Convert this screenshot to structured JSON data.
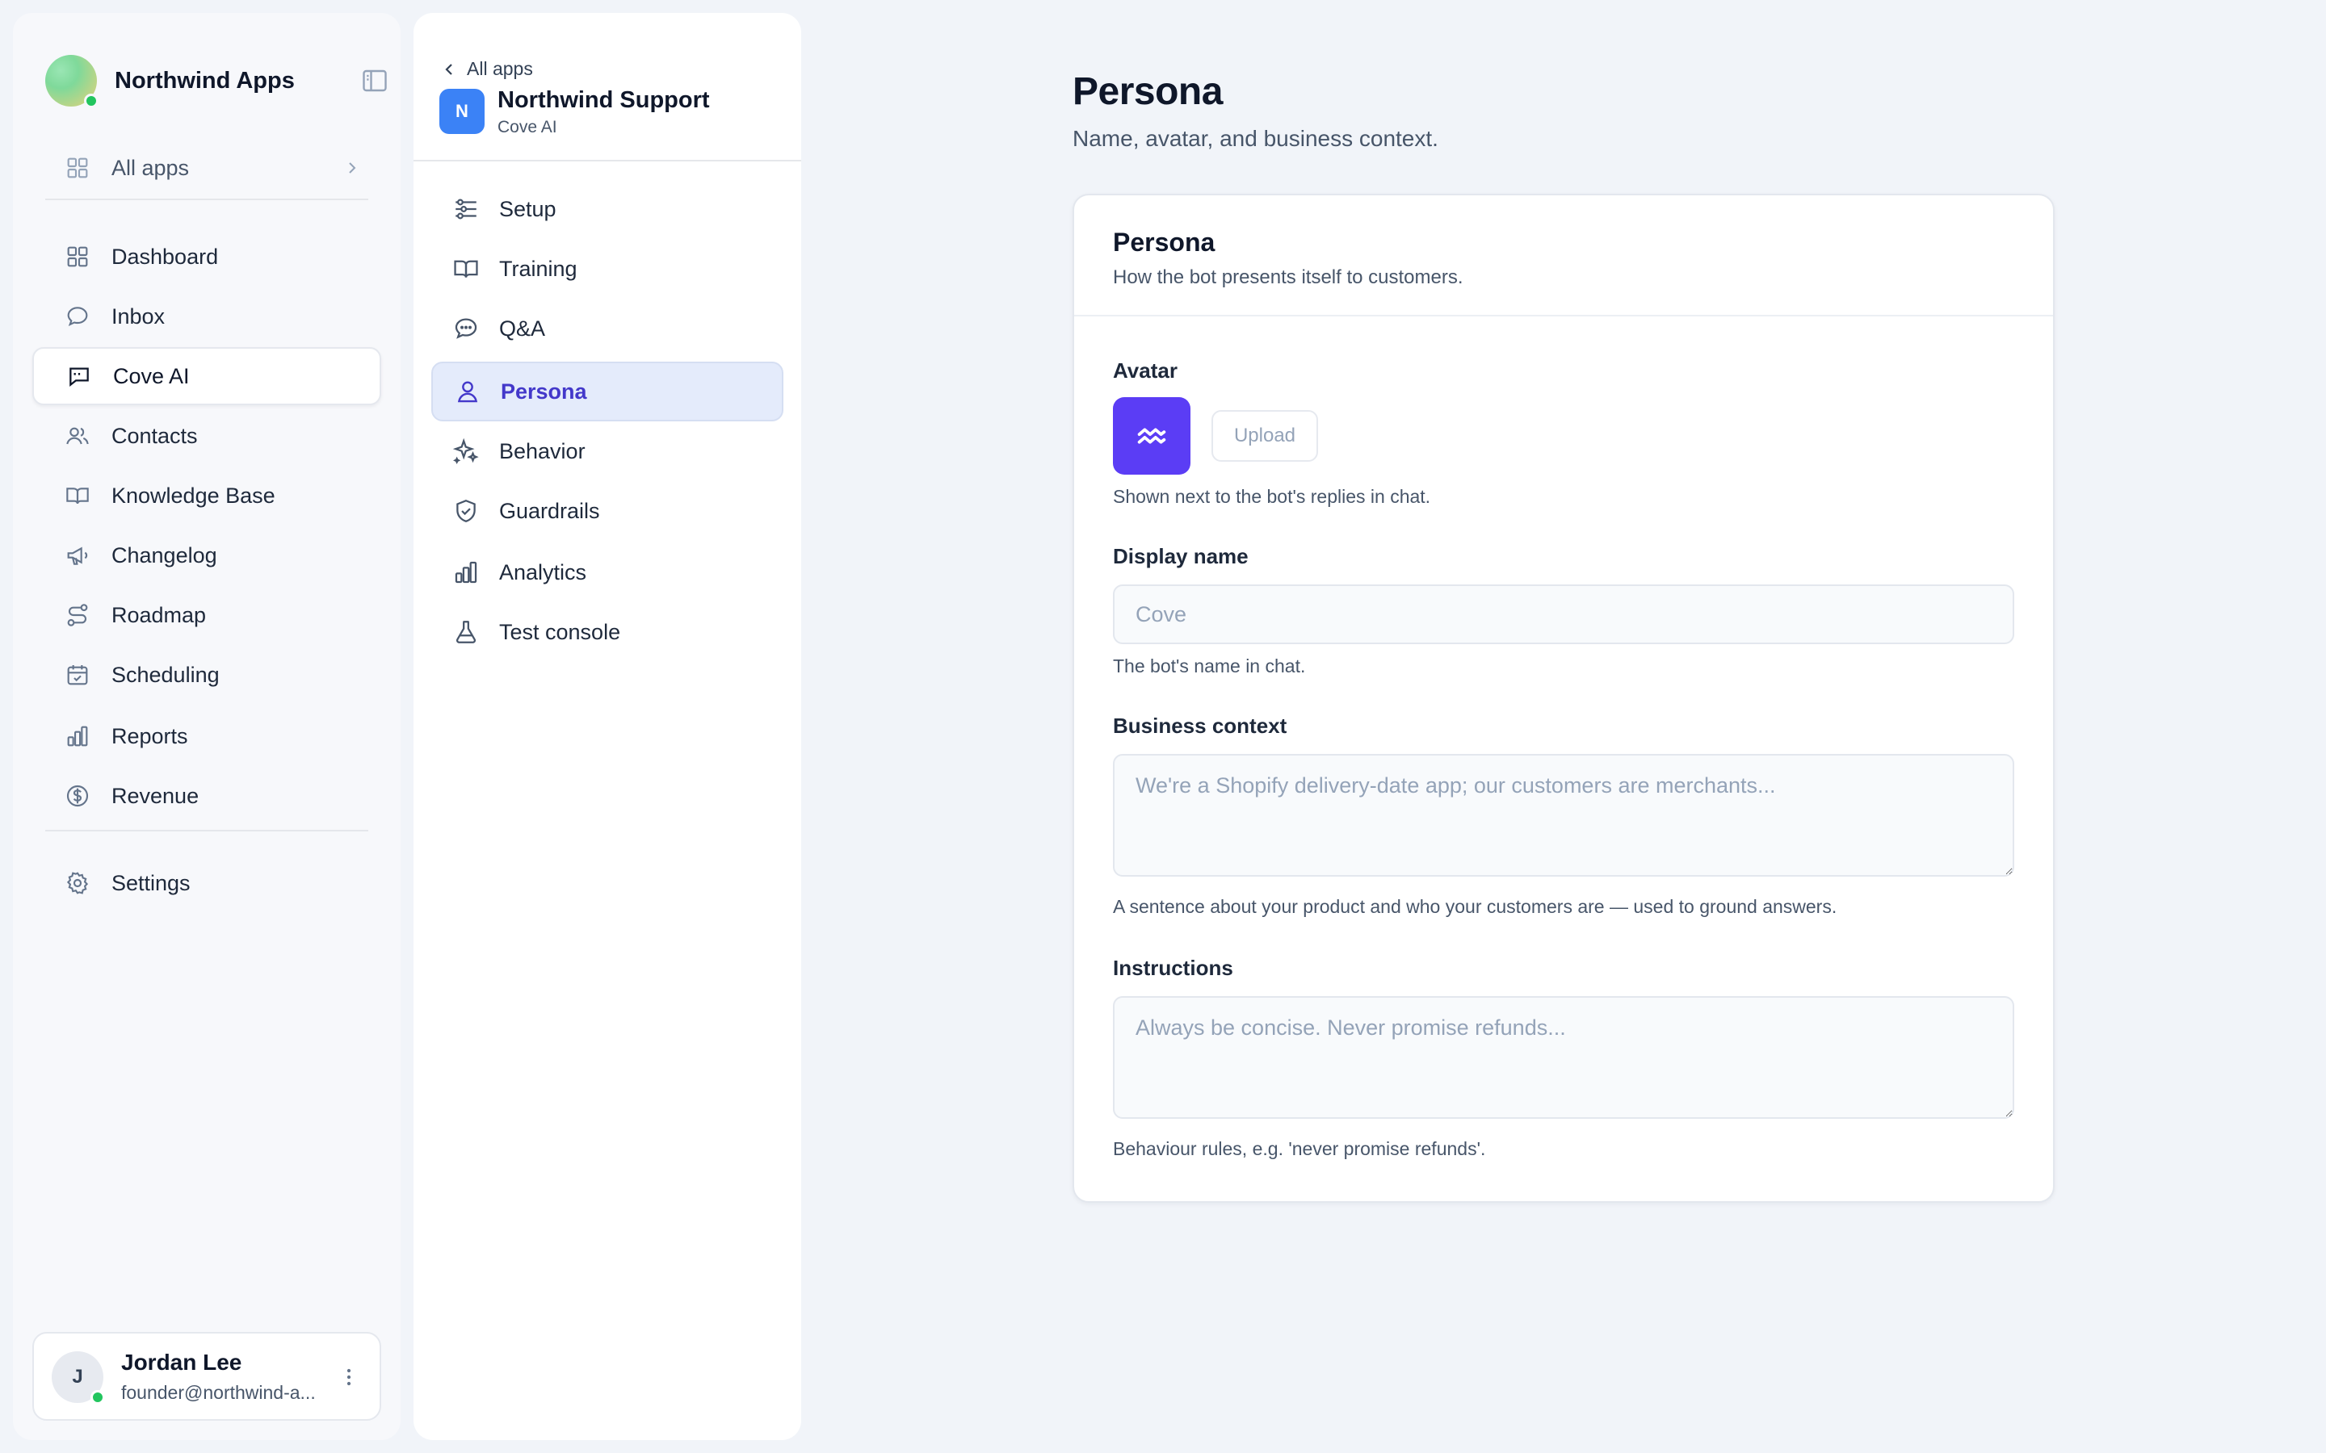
{
  "sidebar": {
    "brand": "Northwind Apps",
    "all_apps": "All apps",
    "items": [
      {
        "label": "Dashboard",
        "icon": "grid-icon"
      },
      {
        "label": "Inbox",
        "icon": "chat-bubble-icon"
      },
      {
        "label": "Cove AI",
        "icon": "message-square-icon",
        "active": true
      },
      {
        "label": "Contacts",
        "icon": "users-icon"
      },
      {
        "label": "Knowledge Base",
        "icon": "book-open-icon"
      },
      {
        "label": "Changelog",
        "icon": "megaphone-icon"
      },
      {
        "label": "Roadmap",
        "icon": "route-icon"
      },
      {
        "label": "Scheduling",
        "icon": "calendar-check-icon"
      },
      {
        "label": "Reports",
        "icon": "bar-chart-icon"
      },
      {
        "label": "Revenue",
        "icon": "dollar-circle-icon"
      }
    ],
    "settings": "Settings",
    "user": {
      "initial": "J",
      "name": "Jordan Lee",
      "email": "founder@northwind-a..."
    }
  },
  "app_panel": {
    "back": "All apps",
    "badge": "N",
    "title": "Northwind Support",
    "subtitle": "Cove AI",
    "items": [
      {
        "label": "Setup",
        "icon": "sliders-icon"
      },
      {
        "label": "Training",
        "icon": "book-open-icon"
      },
      {
        "label": "Q&A",
        "icon": "chat-bubble-icon"
      },
      {
        "label": "Persona",
        "icon": "user-icon",
        "active": true
      },
      {
        "label": "Behavior",
        "icon": "sparkles-icon"
      },
      {
        "label": "Guardrails",
        "icon": "shield-check-icon"
      },
      {
        "label": "Analytics",
        "icon": "bar-chart-icon"
      },
      {
        "label": "Test console",
        "icon": "flask-icon"
      }
    ]
  },
  "main": {
    "title": "Persona",
    "subtitle": "Name, avatar, and business context.",
    "card": {
      "title": "Persona",
      "subtitle": "How the bot presents itself to customers.",
      "avatar_label": "Avatar",
      "upload_label": "Upload",
      "avatar_hint": "Shown next to the bot's replies in chat.",
      "display_name_label": "Display name",
      "display_name_placeholder": "Cove",
      "display_name_hint": "The bot's name in chat.",
      "business_context_label": "Business context",
      "business_context_placeholder": "We're a Shopify delivery-date app; our customers are merchants...",
      "business_context_hint": "A sentence about your product and who your customers are — used to ground answers.",
      "instructions_label": "Instructions",
      "instructions_placeholder": "Always be concise. Never promise refunds...",
      "instructions_hint": "Behaviour rules, e.g. 'never promise refunds'."
    }
  },
  "colors": {
    "accent": "#4338ca",
    "avatar_bg": "#5b3df5",
    "app_badge": "#3b82f6",
    "online": "#22c55e",
    "active_bg": "#e4ebfb"
  }
}
